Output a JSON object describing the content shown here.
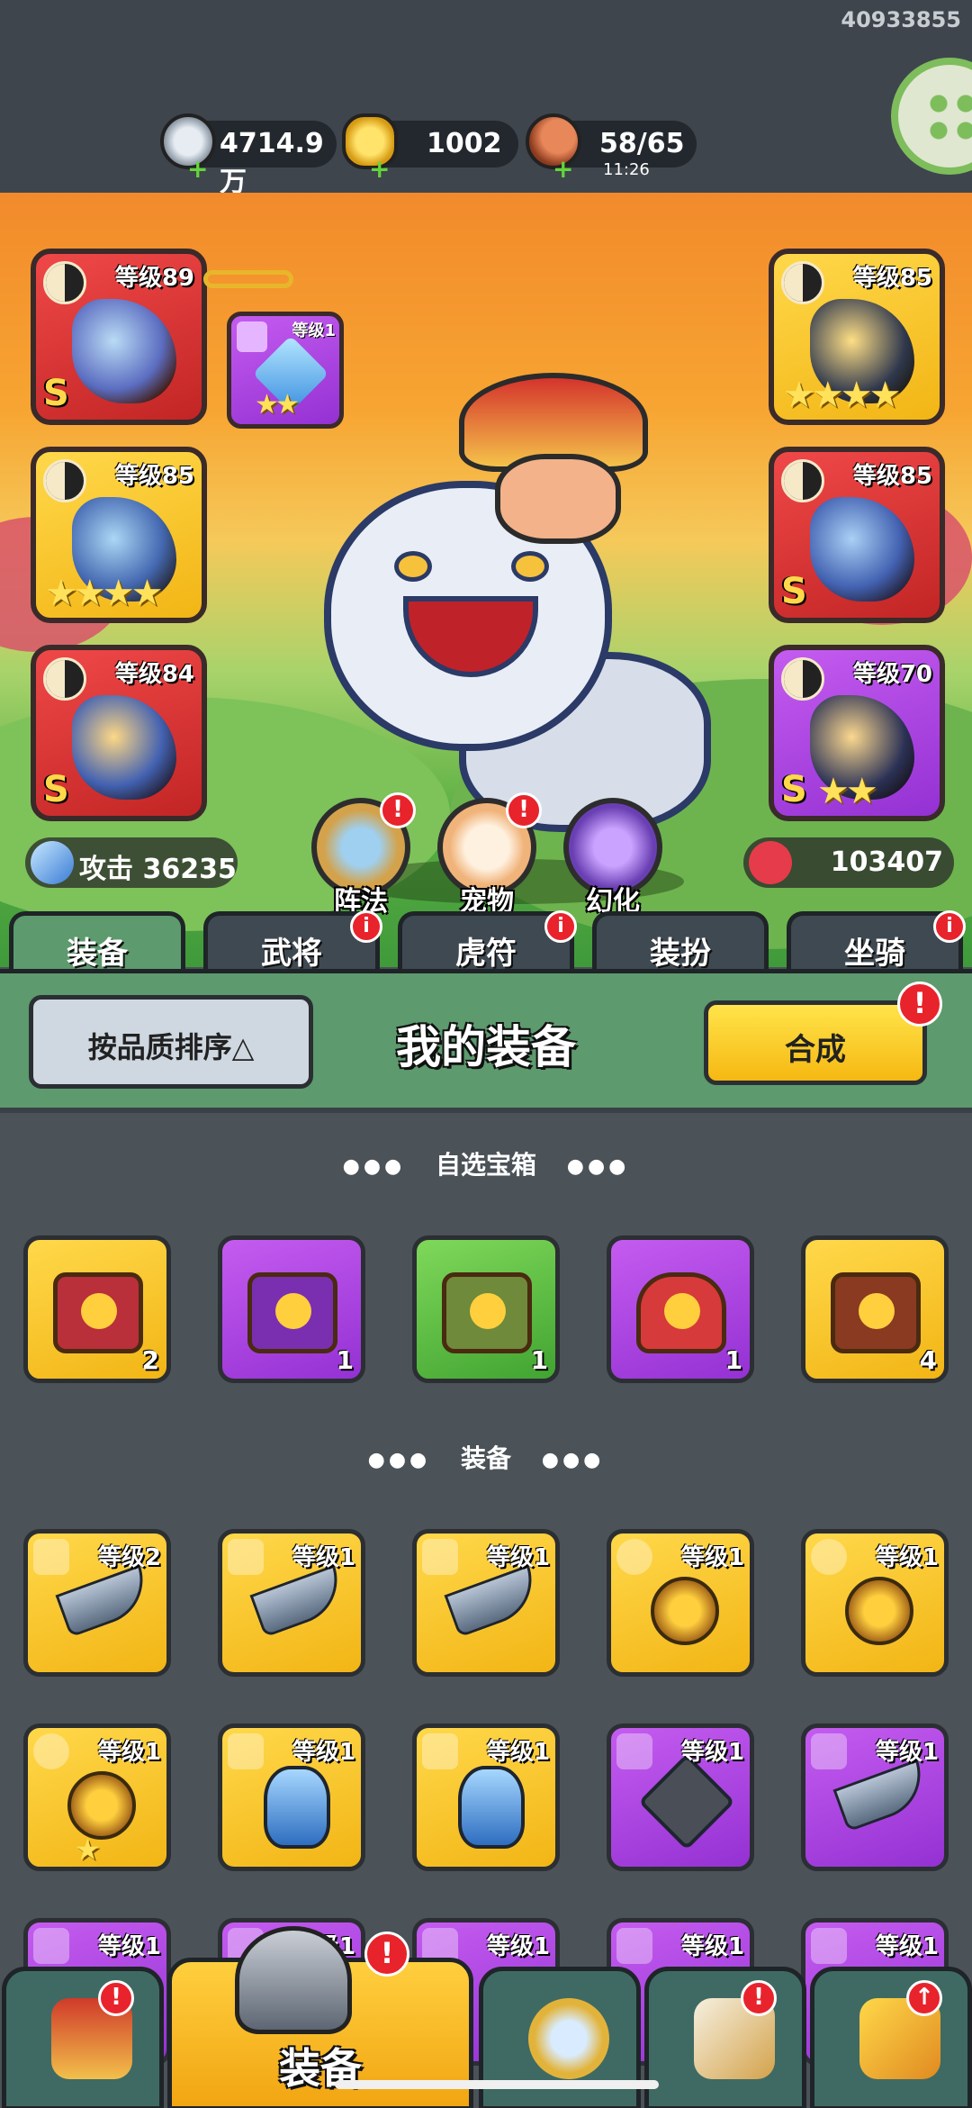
{
  "header": {
    "user_id": "40933855",
    "resources": [
      {
        "name": "silver",
        "value": "4714.9万",
        "icon": "silver-coin-icon",
        "plus": "+"
      },
      {
        "name": "gold",
        "value": "1002",
        "icon": "gold-ingot-icon",
        "plus": "+"
      },
      {
        "name": "stamina",
        "value": "58/65",
        "timer": "11:26",
        "icon": "meat-icon",
        "plus": "+"
      }
    ],
    "menu_icon": "grid-menu-icon"
  },
  "stage": {
    "left_slots": [
      {
        "level": "等级89",
        "rank": "S",
        "rarity": "red"
      },
      {
        "level": "等级85",
        "stars": "★★★★",
        "rarity": "gold"
      },
      {
        "level": "等级84",
        "rank": "S",
        "rarity": "red"
      }
    ],
    "right_slots": [
      {
        "level": "等级85",
        "stars": "★★★★",
        "rarity": "gold"
      },
      {
        "level": "等级85",
        "rank": "S",
        "rarity": "red"
      },
      {
        "level": "等级70",
        "rank": "S",
        "stars": "★★",
        "rarity": "purple"
      }
    ],
    "pendant": {
      "level": "等级1",
      "stars": "★★"
    },
    "buttons": [
      {
        "label": "阵法",
        "badge": "!"
      },
      {
        "label": "宠物",
        "badge": "!"
      },
      {
        "label": "幻化",
        "badge": ""
      }
    ],
    "attack": {
      "label": "攻击 36235",
      "icon": "sword-icon"
    },
    "hp": {
      "label": "103407",
      "icon": "heart-icon"
    }
  },
  "tabs": [
    {
      "label": "装备",
      "badge": ""
    },
    {
      "label": "武将",
      "badge": "i"
    },
    {
      "label": "虎符",
      "badge": "i"
    },
    {
      "label": "装扮",
      "badge": ""
    },
    {
      "label": "坐骑",
      "badge": "i"
    }
  ],
  "panel": {
    "sort_label": "按品质排序△",
    "title": "我的装备",
    "merge_label": "合成",
    "merge_badge": "!"
  },
  "sections": {
    "chests_title": "自选宝箱",
    "equip_title": "装备",
    "dots": "●●●"
  },
  "chests": [
    {
      "count": "2",
      "rarity": "gold"
    },
    {
      "count": "1",
      "rarity": "purple"
    },
    {
      "count": "1",
      "rarity": "green"
    },
    {
      "count": "1",
      "rarity": "purple"
    },
    {
      "count": "4",
      "rarity": "gold"
    }
  ],
  "equipment_row1": [
    {
      "level": "等级2",
      "kind": "blade",
      "rarity": "gold"
    },
    {
      "level": "等级1",
      "kind": "blade",
      "rarity": "gold"
    },
    {
      "level": "等级1",
      "kind": "blade",
      "rarity": "gold"
    },
    {
      "level": "等级1",
      "kind": "amulet",
      "rarity": "gold"
    },
    {
      "level": "等级1",
      "kind": "amulet",
      "rarity": "gold"
    }
  ],
  "equipment_row2": [
    {
      "level": "等级1",
      "kind": "amulet",
      "rarity": "gold",
      "star": "★"
    },
    {
      "level": "等级1",
      "kind": "armor",
      "rarity": "gold"
    },
    {
      "level": "等级1",
      "kind": "armor",
      "rarity": "gold"
    },
    {
      "level": "等级1",
      "kind": "shuriken",
      "rarity": "purple"
    },
    {
      "level": "等级1",
      "kind": "blade",
      "rarity": "purple"
    }
  ],
  "equipment_row3": [
    {
      "level": "等级1"
    },
    {
      "level": "等级1"
    },
    {
      "level": "等级1"
    },
    {
      "level": "等级1"
    },
    {
      "level": "等级1"
    }
  ],
  "bottom_nav": [
    {
      "label": "",
      "icon": "gate-icon",
      "badge": "!"
    },
    {
      "label": "装备",
      "icon": "helmet-icon",
      "badge": "!"
    },
    {
      "label": "",
      "icon": "swords-icon",
      "badge": ""
    },
    {
      "label": "",
      "icon": "horn-icon",
      "badge": "!"
    },
    {
      "label": "",
      "icon": "fist-upgrade-icon",
      "badge": "↑"
    }
  ],
  "colors": {
    "red_rarity": "#e43a3a",
    "gold_rarity": "#f7c52a",
    "purple_rarity": "#ad44e0",
    "green_rarity": "#55b83b",
    "panel_green": "#5d9a6e",
    "badge_red": "#e8232c"
  }
}
